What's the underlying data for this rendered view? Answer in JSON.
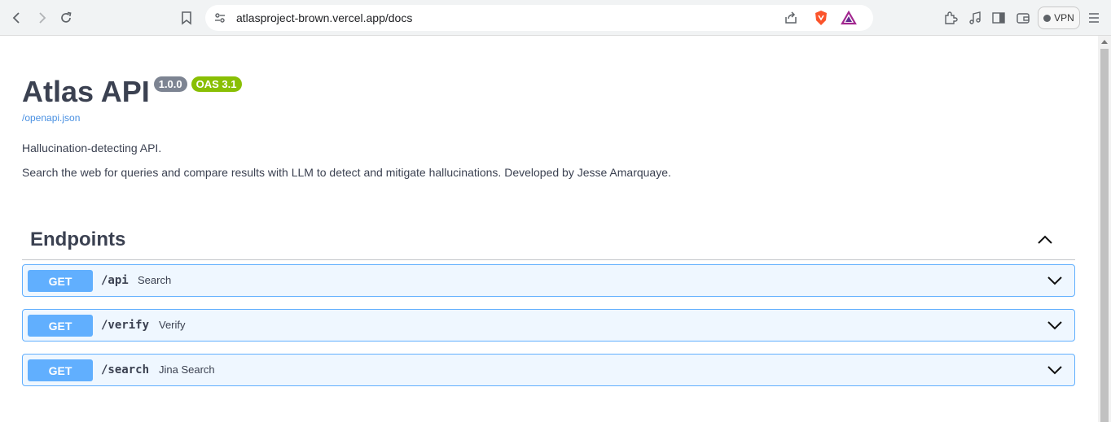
{
  "browser": {
    "url": "atlasproject-brown.vercel.app/docs",
    "vpn_label": "VPN"
  },
  "info": {
    "title": "Atlas API",
    "version": "1.0.0",
    "oas": "OAS 3.1",
    "spec_link": "/openapi.json",
    "description_1": "Hallucination-detecting API.",
    "description_2": "Search the web for queries and compare results with LLM to detect and mitigate hallucinations. Developed by Jesse Amarquaye."
  },
  "section": {
    "title": "Endpoints"
  },
  "operations": [
    {
      "method": "GET",
      "path": "/api",
      "summary": "Search"
    },
    {
      "method": "GET",
      "path": "/verify",
      "summary": "Verify"
    },
    {
      "method": "GET",
      "path": "/search",
      "summary": "Jina Search"
    }
  ],
  "colors": {
    "get_method": "#61affe",
    "version_badge": "#7d8492",
    "oas_badge": "#89bf04",
    "link": "#4990e2"
  },
  "icons": [
    "back-icon",
    "forward-icon",
    "reload-icon",
    "bookmark-icon",
    "site-settings-icon",
    "share-icon",
    "brave-shields-icon",
    "brave-rewards-icon",
    "extensions-icon",
    "media-icon",
    "sidebar-icon",
    "wallet-icon",
    "menu-icon",
    "chevron-up-icon",
    "chevron-down-icon"
  ]
}
